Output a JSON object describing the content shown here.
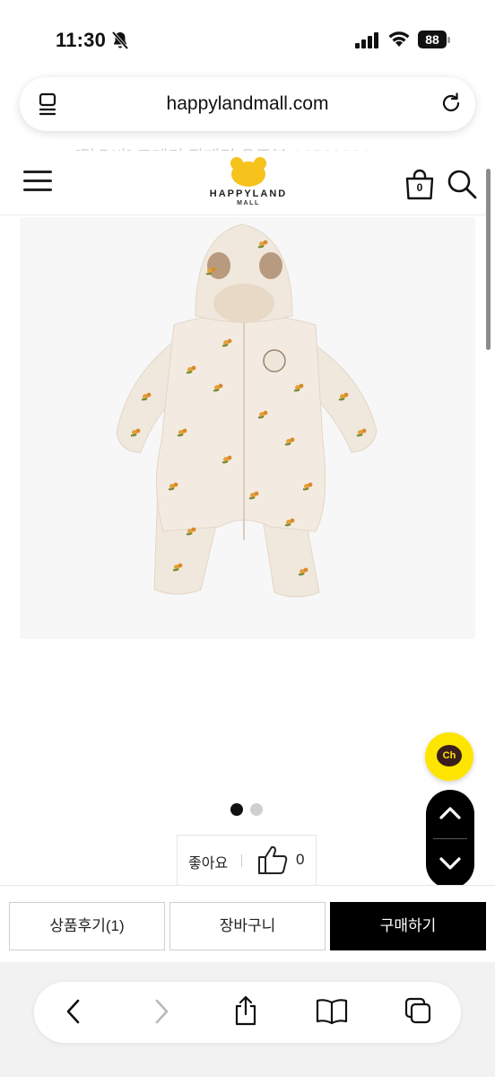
{
  "status_bar": {
    "time": "11:30",
    "battery": "88"
  },
  "browser": {
    "url": "happylandmall.com"
  },
  "page": {
    "ghost_title": "[탑오바] 프레디 작패딩 우주복 A2522204"
  },
  "header": {
    "brand": "HAPPYLAND",
    "brand_sub": "MALL",
    "cart_count": "0"
  },
  "product": {
    "image_alt": "floral print padded baby bodysuit with bear-ear hood",
    "gallery_total": 2,
    "gallery_active": 1
  },
  "like": {
    "label": "좋아요",
    "count": "0"
  },
  "actions": {
    "review_label": "상품후기(1)",
    "cart_label": "장바구니",
    "buy_label": "구매하기"
  },
  "floating": {
    "chat_label": "Ch"
  },
  "colors": {
    "accent_yellow": "#fee500",
    "logo_yellow": "#f6c21c",
    "buy_button": "#000000"
  }
}
